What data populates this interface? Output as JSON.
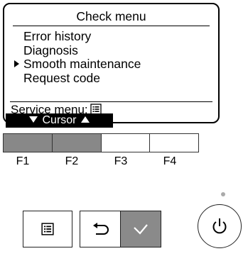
{
  "screen": {
    "title": "Check menu",
    "menu_items": [
      {
        "label": "Error history",
        "selected": false
      },
      {
        "label": "Diagnosis",
        "selected": false
      },
      {
        "label": "Smooth maintenance",
        "selected": true
      },
      {
        "label": "Request code",
        "selected": false
      }
    ],
    "service_label": "Service menu:",
    "service_icon": "menu-list-icon",
    "cursor_label": "Cursor"
  },
  "function_keys": [
    {
      "label": "F1",
      "active": true
    },
    {
      "label": "F2",
      "active": true
    },
    {
      "label": "F3",
      "active": false
    },
    {
      "label": "F4",
      "active": false
    }
  ],
  "buttons": {
    "menu_icon": "menu-list-icon",
    "back_icon": "return-arrow-icon",
    "ok_icon": "checkmark-icon",
    "power_icon": "power-icon"
  },
  "colors": {
    "active_key": "#888888",
    "ok_button": "#8a8a8a",
    "led": "#aaaaaa"
  }
}
